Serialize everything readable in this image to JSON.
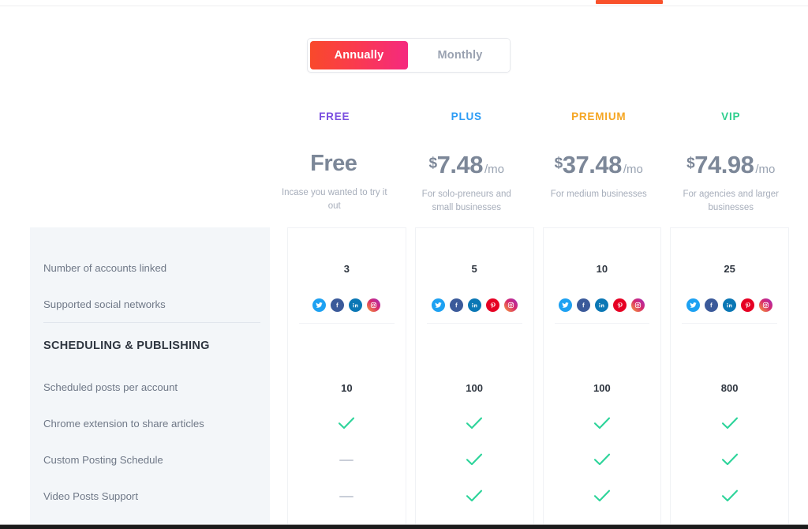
{
  "topbar": {
    "active_tab_indicator": "active-tab"
  },
  "billing_toggle": {
    "options": [
      {
        "label": "Annually",
        "active": true
      },
      {
        "label": "Monthly",
        "active": false
      }
    ]
  },
  "plans": [
    {
      "name": "FREE",
      "name_color": "#7b4fe0",
      "currency": "",
      "amount": "Free",
      "period": "",
      "description": "Incase you wanted to try it out"
    },
    {
      "name": "PLUS",
      "name_color": "#2d9cf5",
      "currency": "$",
      "amount": "7.48",
      "period": "/mo",
      "description": "For solo-preneurs and small businesses"
    },
    {
      "name": "PREMIUM",
      "name_color": "#f5a623",
      "currency": "$",
      "amount": "37.48",
      "period": "/mo",
      "description": "For medium businesses"
    },
    {
      "name": "VIP",
      "name_color": "#2fcf8e",
      "currency": "$",
      "amount": "74.98",
      "period": "/mo",
      "description": "For agencies and larger businesses"
    }
  ],
  "comparison": {
    "rows": [
      {
        "type": "feature",
        "label": "Number of accounts linked",
        "values": [
          {
            "kind": "text",
            "text": "3"
          },
          {
            "kind": "text",
            "text": "5"
          },
          {
            "kind": "text",
            "text": "10"
          },
          {
            "kind": "text",
            "text": "25"
          }
        ]
      },
      {
        "type": "feature",
        "label": "Supported social networks",
        "values": [
          {
            "kind": "socials",
            "networks": [
              "twitter",
              "facebook",
              "linkedin",
              "instagram"
            ]
          },
          {
            "kind": "socials",
            "networks": [
              "twitter",
              "facebook",
              "linkedin",
              "pinterest",
              "instagram"
            ]
          },
          {
            "kind": "socials",
            "networks": [
              "twitter",
              "facebook",
              "linkedin",
              "pinterest",
              "instagram"
            ]
          },
          {
            "kind": "socials",
            "networks": [
              "twitter",
              "facebook",
              "linkedin",
              "pinterest",
              "instagram"
            ]
          }
        ]
      },
      {
        "type": "divider"
      },
      {
        "type": "section",
        "label": "SCHEDULING & PUBLISHING"
      },
      {
        "type": "feature",
        "label": "Scheduled posts per account",
        "values": [
          {
            "kind": "text",
            "text": "10"
          },
          {
            "kind": "text",
            "text": "100"
          },
          {
            "kind": "text",
            "text": "100"
          },
          {
            "kind": "text",
            "text": "800"
          }
        ]
      },
      {
        "type": "feature",
        "label": "Chrome extension to share articles",
        "values": [
          {
            "kind": "check"
          },
          {
            "kind": "check"
          },
          {
            "kind": "check"
          },
          {
            "kind": "check"
          }
        ]
      },
      {
        "type": "feature",
        "label": "Custom Posting Schedule",
        "values": [
          {
            "kind": "dash"
          },
          {
            "kind": "check"
          },
          {
            "kind": "check"
          },
          {
            "kind": "check"
          }
        ]
      },
      {
        "type": "feature",
        "label": "Video Posts Support",
        "values": [
          {
            "kind": "dash"
          },
          {
            "kind": "check"
          },
          {
            "kind": "check"
          },
          {
            "kind": "check"
          }
        ]
      }
    ]
  },
  "colors": {
    "accent_gradient_start": "#f9492b",
    "accent_gradient_end": "#f5297f",
    "check_green": "#2dd49a",
    "dash_gray": "#c9ced8",
    "panel_bg": "#f3f6f9",
    "tab_indicator": "#f9512b"
  }
}
